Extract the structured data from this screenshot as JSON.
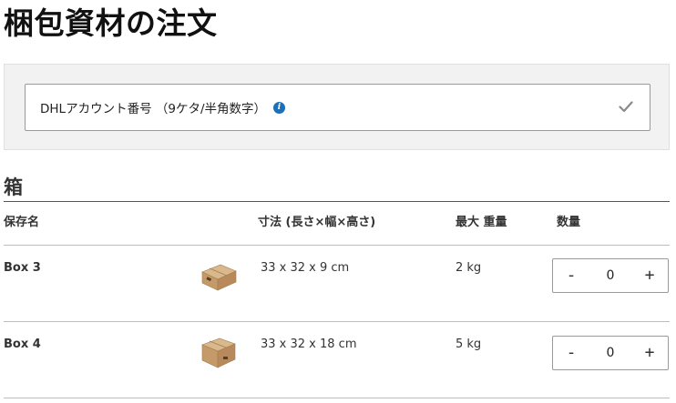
{
  "page": {
    "title": "梱包資材の注文"
  },
  "account": {
    "label": "DHLアカウント番号 （9ケタ/半角数字）",
    "info_icon": "info-icon",
    "status_icon": "check-icon"
  },
  "section": {
    "title": "箱"
  },
  "table": {
    "headers": [
      "保存名",
      "寸法 (長さ×幅×高さ)",
      "最大 重量",
      "数量"
    ],
    "rows": [
      {
        "name": "Box 3",
        "dimensions": "33 x 32 x 9 cm",
        "max_weight": "2 kg",
        "quantity": "0",
        "image_icon": "box-image"
      },
      {
        "name": "Box 4",
        "dimensions": "33 x 32 x 18 cm",
        "max_weight": "5 kg",
        "quantity": "0",
        "image_icon": "box-image"
      }
    ],
    "minus_label": "-",
    "plus_label": "+"
  },
  "colors": {
    "info_blue": "#1d6fb8",
    "panel_bg": "#f2f2f2",
    "box_brown": "#c9a277"
  }
}
